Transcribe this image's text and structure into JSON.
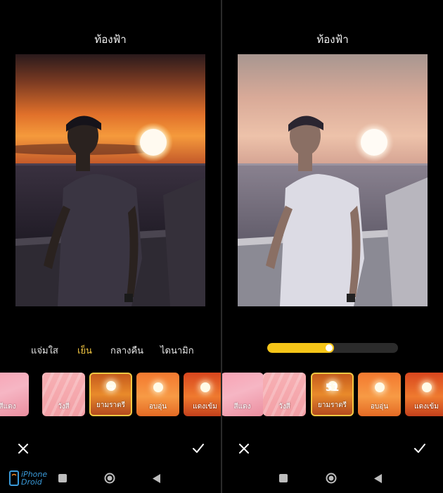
{
  "left": {
    "title": "ท้องฟ้า",
    "tabs": [
      {
        "label": "แจ่มใส",
        "active": false
      },
      {
        "label": "เย็น",
        "active": true
      },
      {
        "label": "กลางคืน",
        "active": false
      },
      {
        "label": "ไดนามิก",
        "active": false
      }
    ],
    "presets": [
      {
        "label": "สีแดง",
        "style": "pink",
        "selected": false
      },
      {
        "label": "วังสี",
        "style": "rays",
        "selected": false
      },
      {
        "label": "ยามราตรี",
        "style": "dusk",
        "selected": true,
        "overlay": "⇆"
      },
      {
        "label": "อบอุ่น",
        "style": "warm",
        "selected": false
      },
      {
        "label": "แดงเข้ม",
        "style": "red",
        "selected": false
      }
    ]
  },
  "right": {
    "title": "ท้องฟ้า",
    "slider": {
      "value": 51,
      "max": 100
    },
    "presets": [
      {
        "label": "สีแดง",
        "style": "pink",
        "selected": false
      },
      {
        "label": "วังสี",
        "style": "rays",
        "selected": false
      },
      {
        "label": "ยามราตรี",
        "style": "dusk",
        "selected": true,
        "overlay": "51"
      },
      {
        "label": "อบอุ่น",
        "style": "warm",
        "selected": false
      },
      {
        "label": "แดงเข้ม",
        "style": "red",
        "selected": false
      }
    ]
  },
  "icons": {
    "cancel": "close-icon",
    "confirm": "check-icon",
    "nav_recent": "square-icon",
    "nav_home": "circle-icon",
    "nav_back": "triangle-back-icon"
  },
  "colors": {
    "accent": "#f5c842",
    "slider_fill": "#f5c518",
    "background": "#000000"
  },
  "watermark": {
    "line1": "iPhone",
    "line2": "Droid"
  }
}
